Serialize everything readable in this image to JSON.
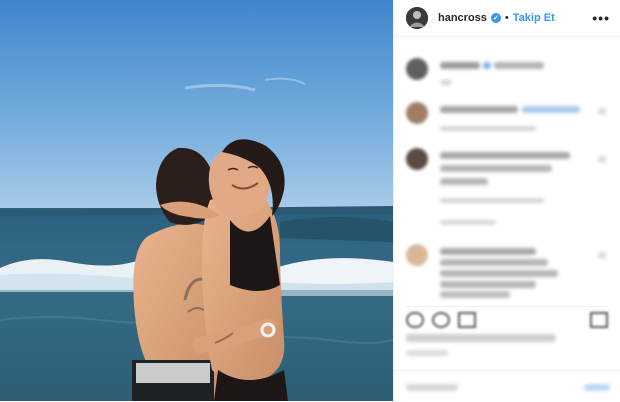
{
  "post": {
    "header": {
      "username": "hancross",
      "separator": "•",
      "follow_label": "Takip Et",
      "more_glyph": "•••",
      "verified_glyph": "✓"
    },
    "colors": {
      "accent": "#3897f0",
      "text": "#262626",
      "divider": "#efefef"
    },
    "comments_blurred": true
  }
}
